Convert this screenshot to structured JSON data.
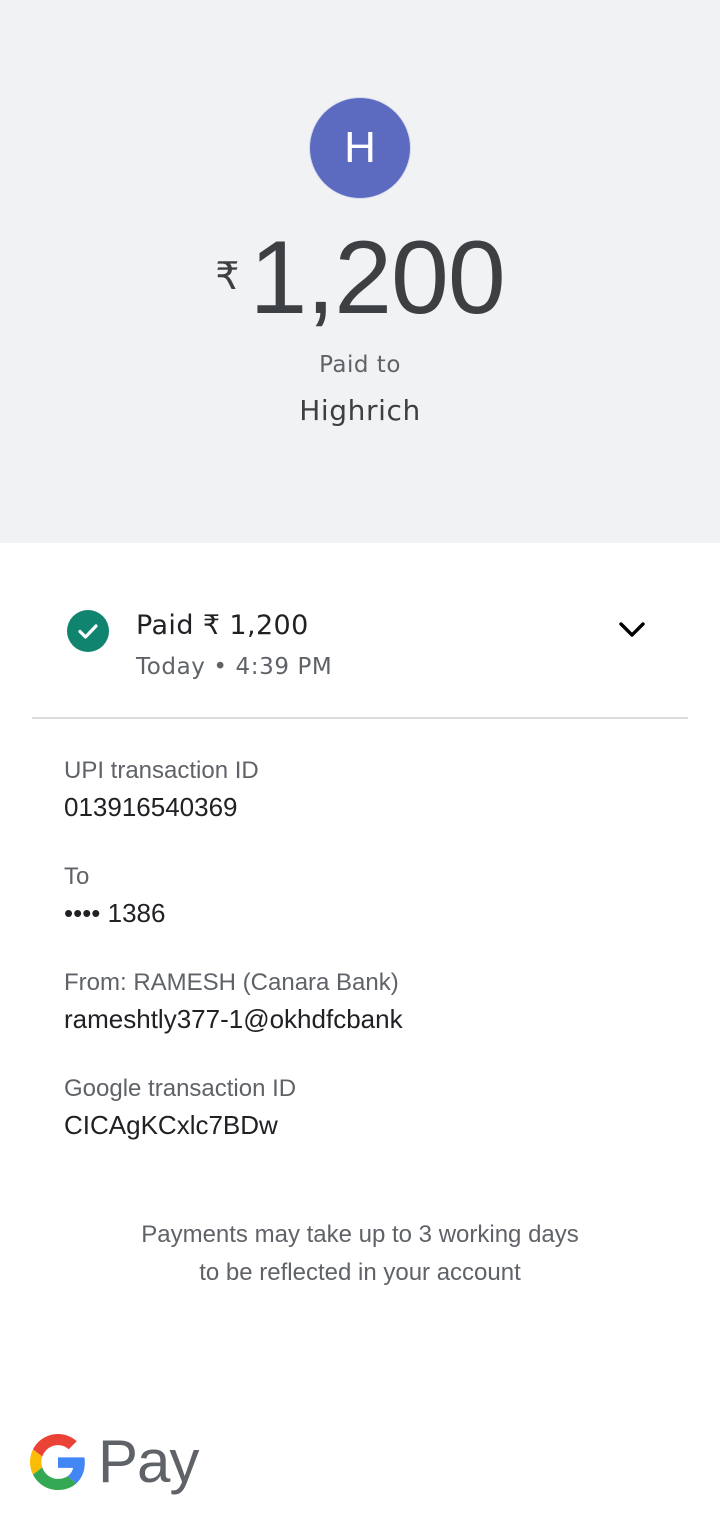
{
  "header": {
    "avatar_initial": "H",
    "currency_symbol": "₹",
    "amount": "1,200",
    "paid_to_label": "Paid to",
    "payee_name": "Highrich"
  },
  "status": {
    "title": "Paid ₹ 1,200",
    "time": "Today • 4:39 PM",
    "icon": "check-circle-icon",
    "toggle_icon": "chevron-down-icon"
  },
  "details": {
    "upi_label": "UPI transaction ID",
    "upi_value": "013916540369",
    "to_label": "To",
    "to_value": "•••• 1386",
    "from_label": "From: RAMESH (Canara Bank)",
    "from_value": "rameshtly377-1@okhdfcbank",
    "google_label": "Google transaction ID",
    "google_value": "CICAgKCxlc7BDw"
  },
  "note": {
    "line1": "Payments may take up to 3 working days",
    "line2": "to be reflected in your account"
  },
  "logo": {
    "text": "Pay",
    "icon": "google-g-icon"
  },
  "colors": {
    "header_bg": "#f1f2f4",
    "avatar_bg": "#5c6bc0",
    "success_green": "#118470"
  }
}
